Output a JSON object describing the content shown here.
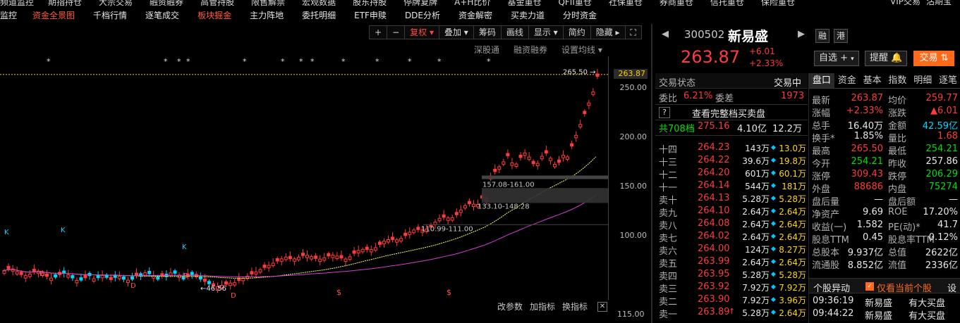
{
  "menu_top": [
    "频道监控",
    "期指持仓",
    "大宗交易",
    "融资融券",
    "高管持股",
    "限售解禁",
    "宏观数据",
    "股东持股",
    "停牌复牌",
    "A+H比价",
    "基金重仓",
    "QFII重仓",
    "社保重仓",
    "券商重仓",
    "信托重仓",
    "保险重仓"
  ],
  "menu_top_right": [
    "VIP交易",
    "沽期宝"
  ],
  "menu_second": [
    {
      "label": "监控",
      "active": false
    },
    {
      "label": "资金全景图",
      "active": true
    },
    {
      "label": "千档行情",
      "active": false
    },
    {
      "label": "逐笔成交",
      "active": false
    },
    {
      "label": "板块掘金",
      "active": true
    },
    {
      "label": "主力阵地",
      "active": false
    },
    {
      "label": "委托明细",
      "active": false
    },
    {
      "label": "ETF申赎",
      "active": false
    },
    {
      "label": "DDE分析",
      "active": false
    },
    {
      "label": "资金解密",
      "active": false
    },
    {
      "label": "买卖力道",
      "active": false
    },
    {
      "label": "分时资金",
      "active": false
    }
  ],
  "chart_toolbar": [
    "+",
    "−",
    "复权 ▾",
    "叠加 ▾",
    "筹码",
    "画线",
    "显示 ▾",
    "简约",
    "隐藏 ▸",
    "⛶"
  ],
  "chart_sublinks": [
    "深股通",
    "融资融券",
    "设置均线 ▾"
  ],
  "price_axis": [
    "250.00",
    "200.00",
    "150.00",
    "100.00"
  ],
  "current_price_tag": "263.87",
  "chart_annotations": {
    "high_label": "265.50",
    "low_label": "46.56",
    "zone1": "157.08-161.00",
    "zone2": "133.10-148.28",
    "zone3": "110.99-111.00",
    "k_marker": "K",
    "d_marker": "D",
    "star": "*",
    "dollar": "$"
  },
  "bottom_toolbar": [
    "改参数",
    "加指标",
    "换指标"
  ],
  "bottom_close": "✕",
  "bottom_axis_label": "115.00",
  "stock": {
    "code": "300502",
    "name": "新易盛",
    "price": "263.87",
    "change": "+6.01",
    "change_pct": "+2.33%",
    "tag1": "融",
    "tag2": "港",
    "watch_btn": "自选 +",
    "alert_btn": "提醒",
    "trade_btn": "交易"
  },
  "orderbook": {
    "header_left": "交易状态",
    "header_right": "交易中",
    "weibi_label": "委比",
    "weibi": "6.21%",
    "weicha_label": "委差",
    "weicha": "1973",
    "full_depth": "查看完整档买卖盘",
    "total_label": "共708档",
    "total_price": "275.16",
    "total_amt": "4.10亿",
    "total_vol": "12.2万",
    "levels": [
      {
        "label": "十四",
        "price": "264.23",
        "vol": "143万",
        "vol2": "13.0万"
      },
      {
        "label": "十三",
        "price": "264.22",
        "vol": "39.6万",
        "vol2": "19.8万"
      },
      {
        "label": "十二",
        "price": "264.20",
        "vol": "601万",
        "vol2": "60.1万"
      },
      {
        "label": "十一",
        "price": "264.14",
        "vol": "544万",
        "vol2": "181万"
      },
      {
        "label": "卖十",
        "price": "264.13",
        "vol": "5.28万",
        "vol2": "5.28万"
      },
      {
        "label": "卖九",
        "price": "264.10",
        "vol": "2.64万",
        "vol2": "2.64万"
      },
      {
        "label": "卖八",
        "price": "264.08",
        "vol": "2.64万",
        "vol2": "2.64万"
      },
      {
        "label": "卖七",
        "price": "264.02",
        "vol": "2.64万",
        "vol2": "2.64万"
      },
      {
        "label": "卖六",
        "price": "264.00",
        "vol": "124万",
        "vol2": "8.27万"
      },
      {
        "label": "卖五",
        "price": "263.99",
        "vol": "2.64万",
        "vol2": "2.64万"
      },
      {
        "label": "卖四",
        "price": "263.95",
        "vol": "5.28万",
        "vol2": "5.28万"
      },
      {
        "label": "卖三",
        "price": "263.92",
        "vol": "7.92万",
        "vol2": "7.92万"
      },
      {
        "label": "卖二",
        "price": "263.90",
        "vol": "7.92万",
        "vol2": "3.96万"
      },
      {
        "label": "卖一",
        "price": "263.89",
        "vol": "5.28万",
        "vol2": "2.64万"
      }
    ]
  },
  "stats": {
    "tabs": [
      "盘口",
      "资金",
      "基本",
      "指数",
      "明细",
      "逐笔"
    ],
    "rows": [
      {
        "l1": "最新",
        "v1": "263.87",
        "c1": "red",
        "l2": "均价",
        "v2": "259.77",
        "c2": "red"
      },
      {
        "l1": "涨幅",
        "v1": "+2.33%",
        "c1": "red",
        "l2": "涨跌",
        "v2": "▲6.01",
        "c2": "red"
      },
      {
        "l1": "总手",
        "v1": "16.40万",
        "c1": "white",
        "l2": "金额",
        "v2": "42.59亿",
        "c2": "cyan"
      },
      {
        "l1": "换手*",
        "v1": "1.85%",
        "c1": "white",
        "l2": "量比",
        "v2": "1.68",
        "c2": "red"
      },
      {
        "l1": "最高",
        "v1": "265.50",
        "c1": "red",
        "l2": "最低",
        "v2": "254.21",
        "c2": "green"
      },
      {
        "l1": "今开",
        "v1": "254.21",
        "c1": "green",
        "l2": "昨收",
        "v2": "257.86",
        "c2": "white"
      },
      {
        "l1": "涨停",
        "v1": "309.43",
        "c1": "red",
        "l2": "跌停",
        "v2": "206.29",
        "c2": "green"
      },
      {
        "l1": "外盘",
        "v1": "88686",
        "c1": "red",
        "l2": "内盘",
        "v2": "75274",
        "c2": "green"
      },
      {
        "l1": "盘后量",
        "v1": "—",
        "c1": "white",
        "l2": "盘后额",
        "v2": "—",
        "c2": "white"
      },
      {
        "l1": "净资产",
        "v1": "9.69",
        "c1": "white",
        "l2": "ROE",
        "v2": "17.20%",
        "c2": "white"
      },
      {
        "l1": "收益(一)",
        "v1": "1.582",
        "c1": "white",
        "l2": "PE(动)*",
        "v2": "41.7",
        "c2": "white"
      },
      {
        "l1": "股息TTM",
        "v1": "0.45",
        "c1": "white",
        "l2": "股息率TTM",
        "v2": "0.12%",
        "c2": "white"
      },
      {
        "l1": "总股本",
        "v1": "9.937亿",
        "c1": "white",
        "l2": "总值",
        "v2": "2622亿",
        "c2": "white"
      },
      {
        "l1": "流通股",
        "v1": "8.852亿",
        "c1": "white",
        "l2": "流值",
        "v2": "2336亿",
        "c2": "white"
      }
    ],
    "alert_title": "个股异动",
    "alert_only_current": "仅看当前个股",
    "alert_settings": "设",
    "alerts": [
      {
        "time": "09:36:19",
        "name": "新易盛",
        "event": "有大买盘"
      },
      {
        "time": "09:44:22",
        "name": "新易盛",
        "event": "有大买盘"
      }
    ]
  }
}
